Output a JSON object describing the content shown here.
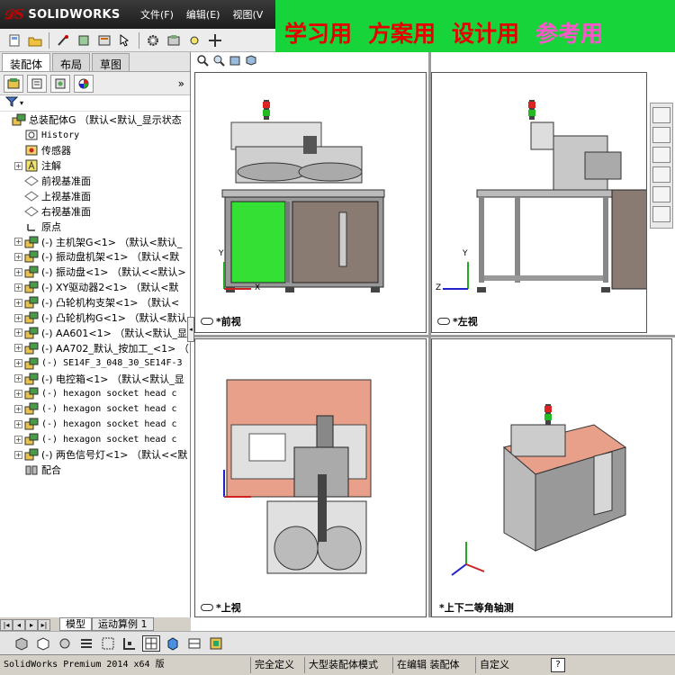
{
  "app": {
    "logo_text": "SOLIDWORKS",
    "menu": [
      "文件(F)",
      "编辑(E)",
      "视图(V"
    ]
  },
  "banner": {
    "items": [
      "学习用",
      "方案用",
      "设计用",
      "参考用"
    ]
  },
  "panel": {
    "tabs": [
      "装配体",
      "布局",
      "草图"
    ],
    "chevron": "»",
    "filter_icon": "filter-icon"
  },
  "tree": {
    "root": "总装配体G （默认<默认_显示状态",
    "items": [
      {
        "label": "History",
        "icon": "history-icon",
        "exp": false,
        "mono": true
      },
      {
        "label": "传感器",
        "icon": "sensor-icon",
        "exp": false
      },
      {
        "label": "注解",
        "icon": "annotation-icon",
        "exp": true
      },
      {
        "label": "前视基准面",
        "icon": "plane-icon",
        "exp": false
      },
      {
        "label": "上视基准面",
        "icon": "plane-icon",
        "exp": false
      },
      {
        "label": "右视基准面",
        "icon": "plane-icon",
        "exp": false
      },
      {
        "label": "原点",
        "icon": "origin-icon",
        "exp": false
      },
      {
        "label": "(-) 主机架G<1> （默认<默认_",
        "icon": "part-icon",
        "exp": true
      },
      {
        "label": "(-) 振动盘机架<1> （默认<默",
        "icon": "part-icon",
        "exp": true
      },
      {
        "label": "(-) 振动盘<1> （默认<<默认>",
        "icon": "part-icon",
        "exp": true
      },
      {
        "label": "(-) XY驱动器2<1> （默认<默",
        "icon": "part-icon",
        "exp": true
      },
      {
        "label": "(-) 凸轮机构支架<1> （默认<",
        "icon": "part-icon",
        "exp": true
      },
      {
        "label": "(-) 凸轮机构G<1> （默认<默认",
        "icon": "part-icon",
        "exp": true
      },
      {
        "label": "(-) AA601<1> （默认<默认_显",
        "icon": "part-icon",
        "exp": true
      },
      {
        "label": "(-) AA702_默认_按加工_<1> （",
        "icon": "part-icon",
        "exp": true
      },
      {
        "label": "(-) SE14F_3_048_30_SE14F-3",
        "icon": "part-icon",
        "exp": true,
        "mono": true
      },
      {
        "label": "(-) 电控箱<1> （默认<默认_显",
        "icon": "part-icon",
        "exp": true
      },
      {
        "label": "(-) hexagon socket head c",
        "icon": "part-icon",
        "exp": true,
        "mono": true
      },
      {
        "label": "(-) hexagon socket head c",
        "icon": "part-icon",
        "exp": true,
        "mono": true
      },
      {
        "label": "(-) hexagon socket head c",
        "icon": "part-icon",
        "exp": true,
        "mono": true
      },
      {
        "label": "(-) hexagon socket head c",
        "icon": "part-icon",
        "exp": true,
        "mono": true
      },
      {
        "label": "(-) 两色信号灯<1> （默认<<默",
        "icon": "part-icon",
        "exp": true
      },
      {
        "label": "配合",
        "icon": "mate-icon",
        "exp": false
      }
    ]
  },
  "bottom_tabs": [
    "模型",
    "运动算例 1"
  ],
  "viewports": {
    "front": "*前视",
    "left": "*左视",
    "top": "*上视",
    "iso": "*上下二等角轴测"
  },
  "axes": {
    "x": "X",
    "y": "Y",
    "z": "Z"
  },
  "status": {
    "product": "SolidWorks Premium 2014 x64 版",
    "items": [
      "完全定义",
      "大型装配体模式",
      "在编辑 装配体",
      "自定义"
    ],
    "help": "?"
  },
  "colors": {
    "banner_bg": "#17d43a",
    "banner_text": "#e60000",
    "banner_accent": "#ff55cc",
    "frame_green": "#35e035",
    "salmon": "#e8a08a"
  }
}
